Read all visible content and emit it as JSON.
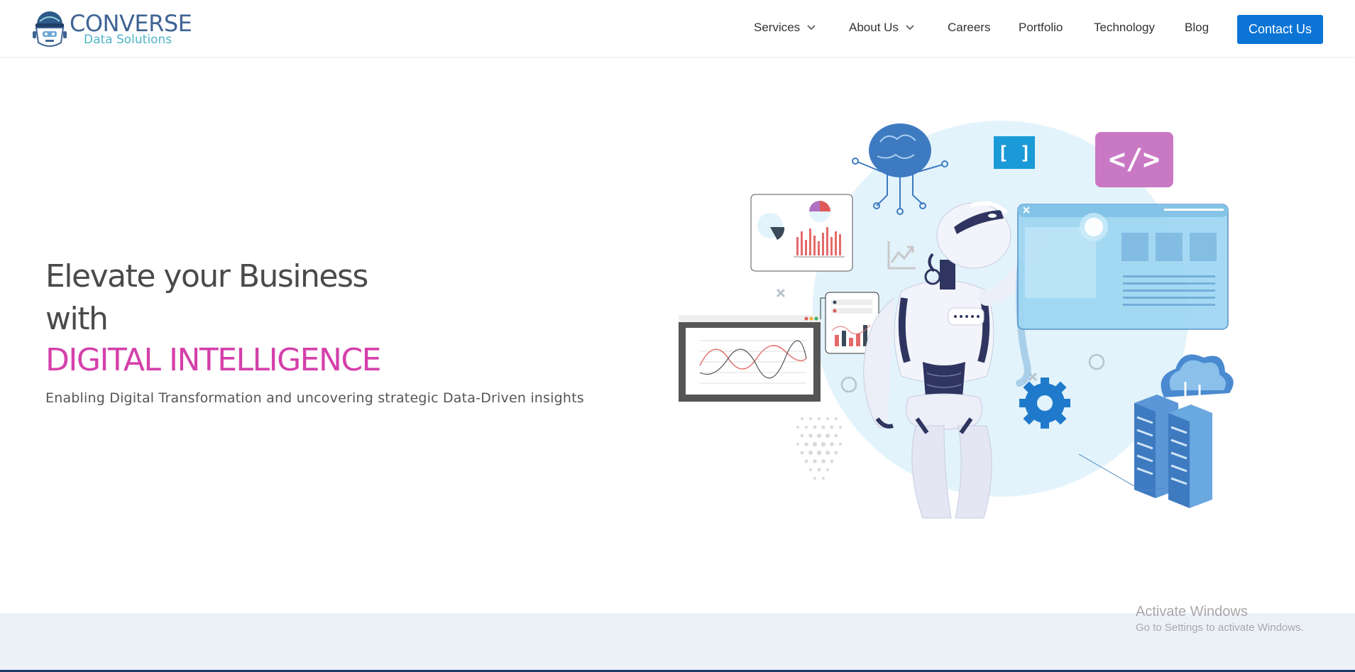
{
  "brand": {
    "name": "CONVERSE",
    "tagline": "Data Solutions",
    "logo_icon": "robot-head-logo-icon"
  },
  "nav": {
    "items": [
      {
        "label": "Services",
        "has_dropdown": true
      },
      {
        "label": "About Us",
        "has_dropdown": true
      },
      {
        "label": "Careers",
        "has_dropdown": false
      },
      {
        "label": "Portfolio",
        "has_dropdown": false
      },
      {
        "label": "Technology",
        "has_dropdown": false
      },
      {
        "label": "Blog",
        "has_dropdown": false
      }
    ],
    "cta_label": "Contact Us"
  },
  "hero": {
    "line1": "Elevate your Business",
    "line2": "with",
    "accent": "DIGITAL INTELLIGENCE",
    "subtitle": "Enabling Digital Transformation and uncovering strategic Data-Driven insights"
  },
  "illustration": {
    "code_brackets_label": "[ ]",
    "code_tag_label": "</>"
  },
  "watermark": {
    "title": "Activate Windows",
    "subtitle": "Go to Settings to activate Windows."
  },
  "colors": {
    "accent_pink": "#d440ab",
    "brand_blue": "#3f6494",
    "brand_teal": "#4fb4c8",
    "cta_blue": "#0b74d5",
    "band_bg": "#ecf1f8"
  }
}
